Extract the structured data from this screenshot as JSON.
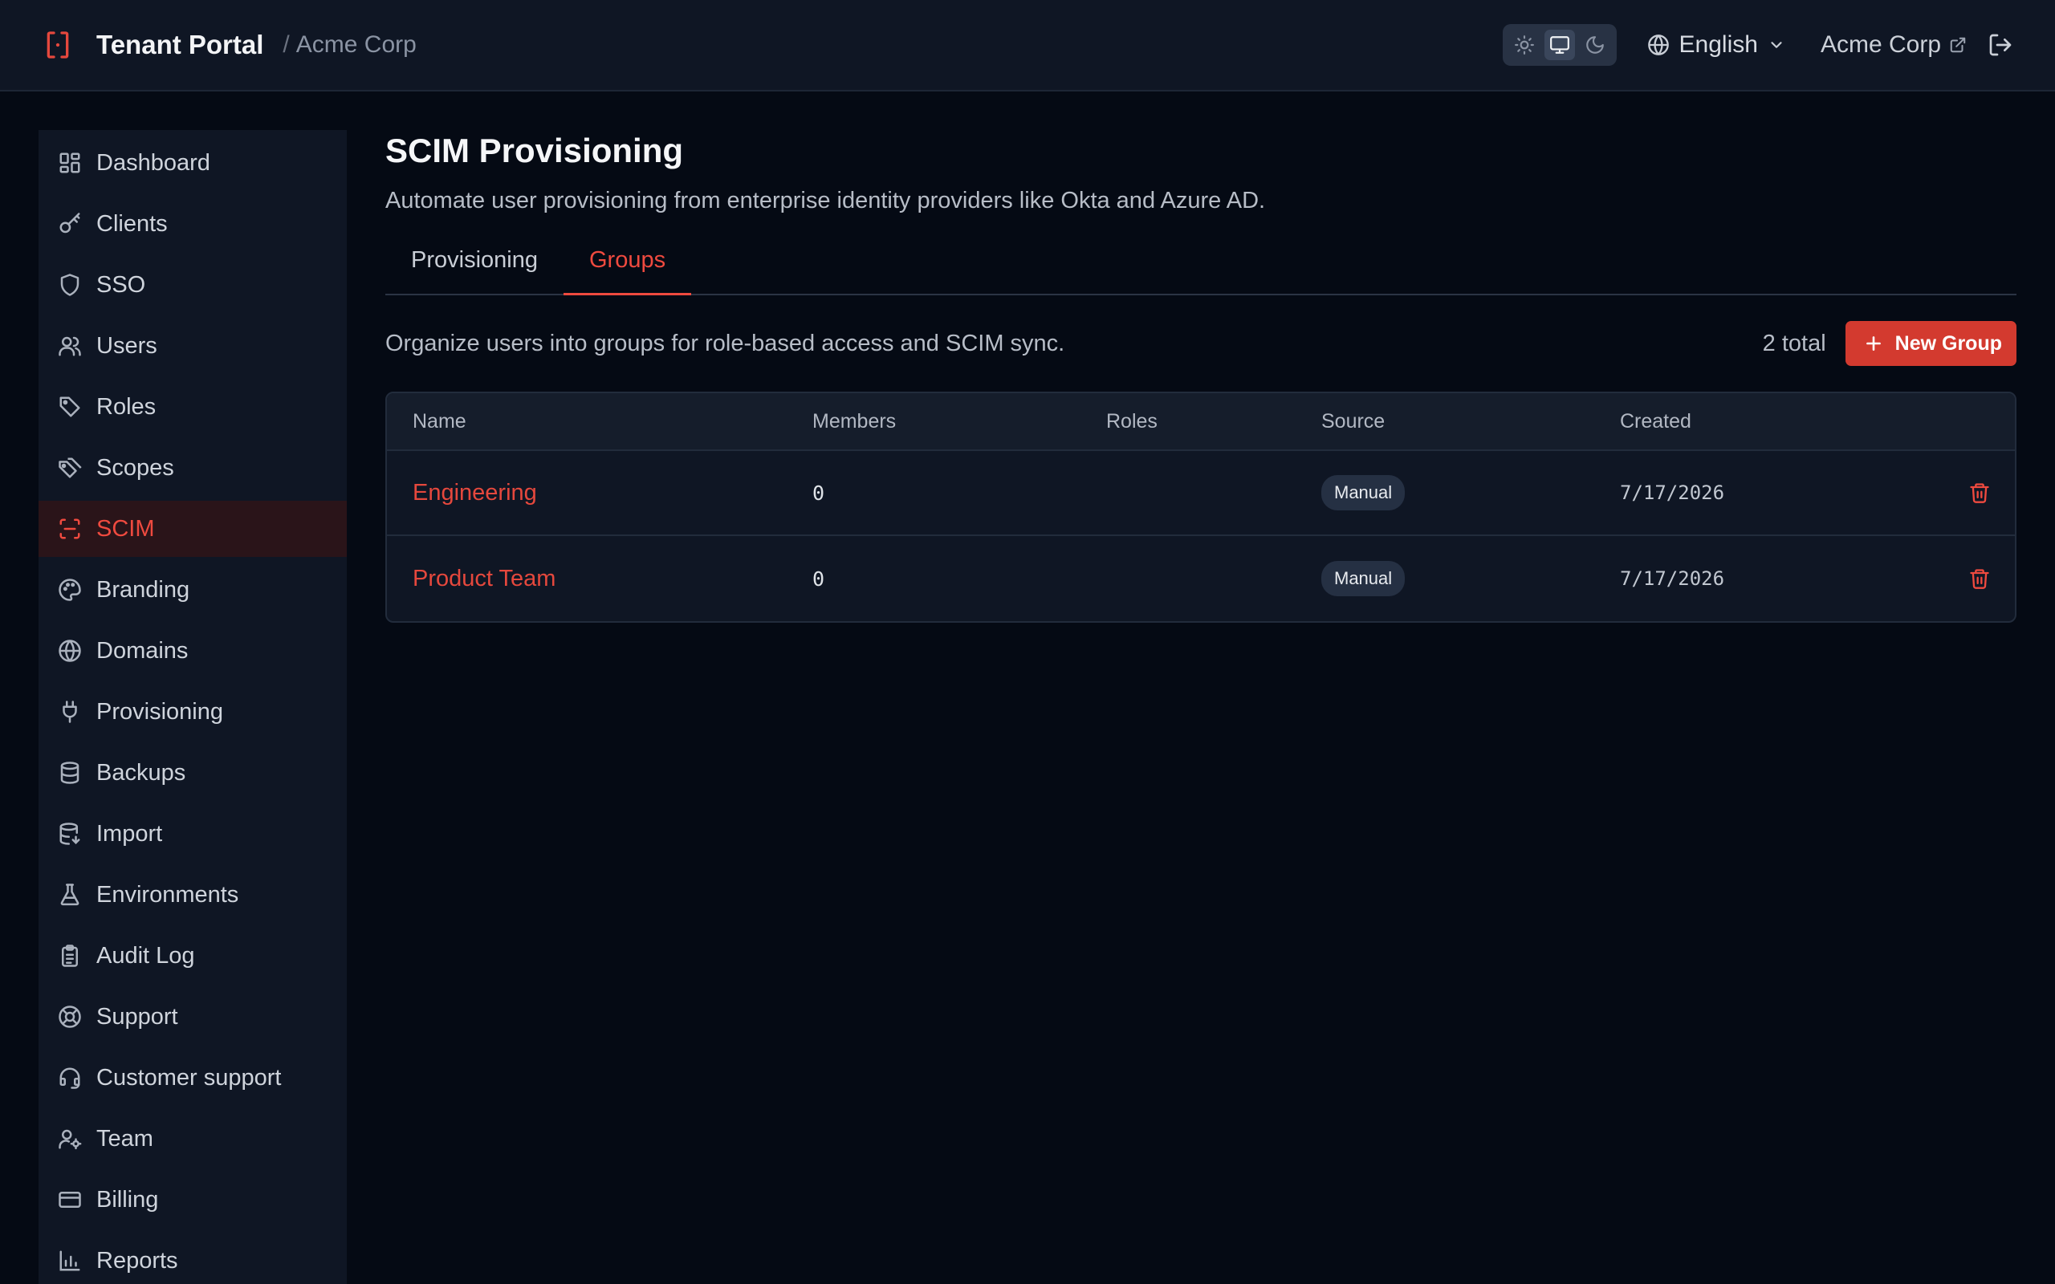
{
  "header": {
    "title": "Tenant Portal",
    "separator": "/",
    "tenant": "Acme Corp",
    "language": "English",
    "org_link": "Acme Corp",
    "theme_active": "system"
  },
  "sidebar": {
    "items": [
      {
        "label": "Dashboard",
        "icon": "dashboard-icon"
      },
      {
        "label": "Clients",
        "icon": "key-icon"
      },
      {
        "label": "SSO",
        "icon": "shield-icon"
      },
      {
        "label": "Users",
        "icon": "users-icon"
      },
      {
        "label": "Roles",
        "icon": "tag-icon"
      },
      {
        "label": "Scopes",
        "icon": "tags-icon"
      },
      {
        "label": "SCIM",
        "icon": "scan-icon",
        "active": true
      },
      {
        "label": "Branding",
        "icon": "palette-icon"
      },
      {
        "label": "Domains",
        "icon": "globe-icon"
      },
      {
        "label": "Provisioning",
        "icon": "plug-icon"
      },
      {
        "label": "Backups",
        "icon": "database-icon"
      },
      {
        "label": "Import",
        "icon": "database-import-icon"
      },
      {
        "label": "Environments",
        "icon": "flask-icon"
      },
      {
        "label": "Audit Log",
        "icon": "clipboard-icon"
      },
      {
        "label": "Support",
        "icon": "life-buoy-icon"
      },
      {
        "label": "Customer support",
        "icon": "headset-icon"
      },
      {
        "label": "Team",
        "icon": "user-cog-icon"
      },
      {
        "label": "Billing",
        "icon": "credit-card-icon"
      },
      {
        "label": "Reports",
        "icon": "bar-chart-icon"
      }
    ]
  },
  "main": {
    "title": "SCIM Provisioning",
    "subtitle": "Automate user provisioning from enterprise identity providers like Okta and Azure AD.",
    "tabs": [
      {
        "label": "Provisioning",
        "active": false
      },
      {
        "label": "Groups",
        "active": true
      }
    ],
    "groups_description": "Organize users into groups for role-based access and SCIM sync.",
    "total": "2 total",
    "new_group_label": "New Group",
    "table": {
      "columns": [
        "Name",
        "Members",
        "Roles",
        "Source",
        "Created"
      ],
      "rows": [
        {
          "name": "Engineering",
          "members": "0",
          "roles": "",
          "source": "Manual",
          "created": "7/17/2026"
        },
        {
          "name": "Product Team",
          "members": "0",
          "roles": "",
          "source": "Manual",
          "created": "7/17/2026"
        }
      ]
    }
  },
  "colors": {
    "accent": "#e5483d",
    "background": "#050a14",
    "panel": "#0f1624"
  }
}
